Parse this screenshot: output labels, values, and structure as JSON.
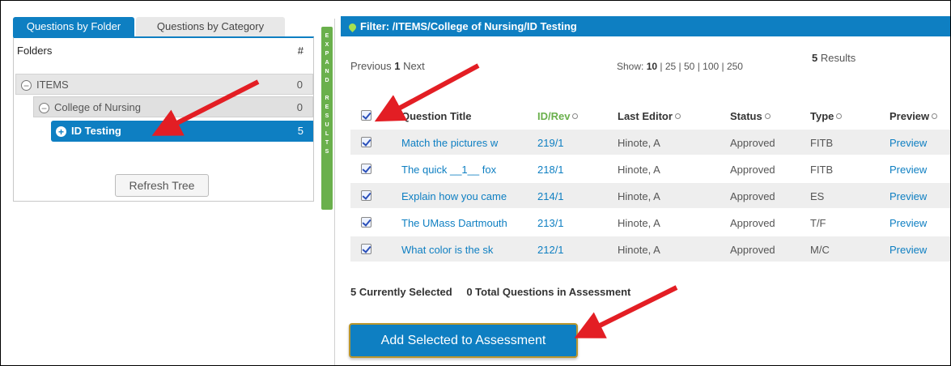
{
  "left_panel": {
    "tabs": [
      {
        "label": "Questions by Folder",
        "active": true
      },
      {
        "label": "Questions by Category",
        "active": false
      }
    ],
    "tree_header": {
      "folders": "Folders",
      "count": "#"
    },
    "tree": [
      {
        "label": "ITEMS",
        "count": "0",
        "toggle": "−"
      },
      {
        "label": "College of Nursing",
        "count": "0",
        "toggle": "−"
      },
      {
        "label": "ID Testing",
        "count": "5",
        "toggle": "+"
      }
    ],
    "refresh_label": "Refresh Tree"
  },
  "expand_bar": {
    "letters": [
      "E",
      "X",
      "P",
      "A",
      "N",
      "D",
      " ",
      "R",
      "E",
      "S",
      "U",
      "L",
      "T",
      "S"
    ]
  },
  "filter": {
    "label": "Filter:",
    "path": "/ITEMS/College of Nursing/ID Testing"
  },
  "pager": {
    "prev": "Previous",
    "page": "1",
    "next": "Next"
  },
  "show": {
    "label": "Show:",
    "selected": "10",
    "options": "25 | 50 | 100 | 250"
  },
  "results": {
    "count": "5",
    "label": "Results"
  },
  "table": {
    "headers": {
      "title": "Question Title",
      "id": "ID/Rev",
      "editor": "Last Editor",
      "status": "Status",
      "type": "Type",
      "preview": "Preview"
    },
    "rows": [
      {
        "title": "Match the pictures w",
        "id": "219/1",
        "editor": "Hinote, A",
        "status": "Approved",
        "type": "FITB",
        "preview": "Preview"
      },
      {
        "title": "The quick __1__ fox",
        "id": "218/1",
        "editor": "Hinote, A",
        "status": "Approved",
        "type": "FITB",
        "preview": "Preview"
      },
      {
        "title": "Explain how you came",
        "id": "214/1",
        "editor": "Hinote, A",
        "status": "Approved",
        "type": "ES",
        "preview": "Preview"
      },
      {
        "title": "The UMass Dartmouth",
        "id": "213/1",
        "editor": "Hinote, A",
        "status": "Approved",
        "type": "T/F",
        "preview": "Preview"
      },
      {
        "title": "What color is the sk",
        "id": "212/1",
        "editor": "Hinote, A",
        "status": "Approved",
        "type": "M/C",
        "preview": "Preview"
      }
    ]
  },
  "summary": {
    "selected": "5 Currently Selected",
    "total": "0 Total Questions in Assessment"
  },
  "add_button": "Add Selected to Assessment",
  "colors": {
    "primary": "#0e7fc2",
    "green": "#6ab04c",
    "arrow": "#e31e24"
  }
}
